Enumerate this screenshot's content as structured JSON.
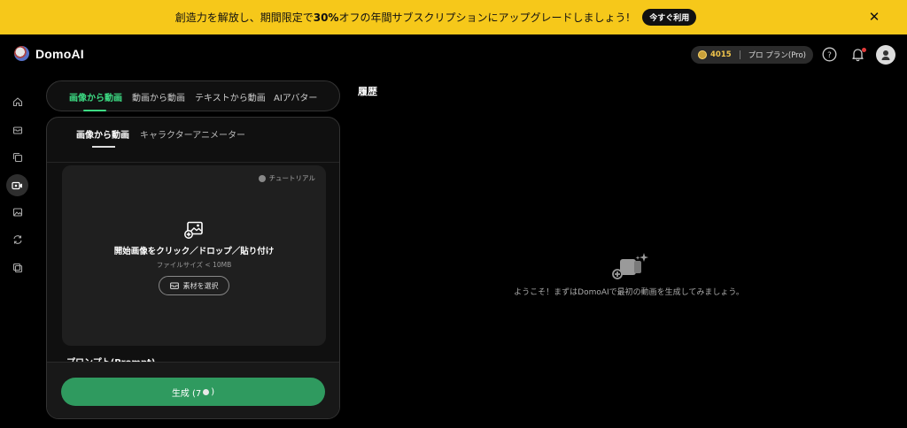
{
  "banner": {
    "message_pre": "創造力を解放し、期間限定で",
    "message_bold": "30%",
    "message_post": "オフの年間サブスクリプションにアップグレードしましょう!",
    "cta": "今すぐ利用",
    "close_icon": "close-icon"
  },
  "header": {
    "brand": "DomoAI",
    "credits": "4015",
    "plan": "プロ プラン(Pro)",
    "icons": [
      "help-icon",
      "bell-icon",
      "avatar"
    ]
  },
  "sidebar": {
    "items": [
      "home-icon",
      "box-icon",
      "layers-icon",
      "video-icon",
      "image-icon",
      "refresh-icon",
      "copy-icon"
    ],
    "active": "video-icon"
  },
  "tabs": [
    {
      "label": "画像から動画",
      "active": true
    },
    {
      "label": "動画から動画",
      "active": false
    },
    {
      "label": "テキストから動画",
      "active": false
    },
    {
      "label": "AIアバター",
      "active": false
    }
  ],
  "subtabs": [
    {
      "label": "画像から動画",
      "active": true
    },
    {
      "label": "キャラクターアニメーター",
      "active": false
    }
  ],
  "dropzone": {
    "tutorial": "チュートリアル",
    "title": "開始画像をクリック／ドロップ／貼り付け",
    "subtitle": "ファイルサイズ < 10MB",
    "button": "素材を選択"
  },
  "prompt_label": "プロンプト(Prompt)",
  "generate": {
    "label_pre": "生成 (7",
    "label_post": ")"
  },
  "history": {
    "title": "履歴",
    "empty_message": "ようこそ！まずはDomoAIで最初の動画を生成してみましょう。"
  },
  "colors": {
    "banner": "#f6c81a",
    "accent": "#3ddc84",
    "generate_button": "#2f9a5f",
    "coin": "#f1c54c"
  }
}
